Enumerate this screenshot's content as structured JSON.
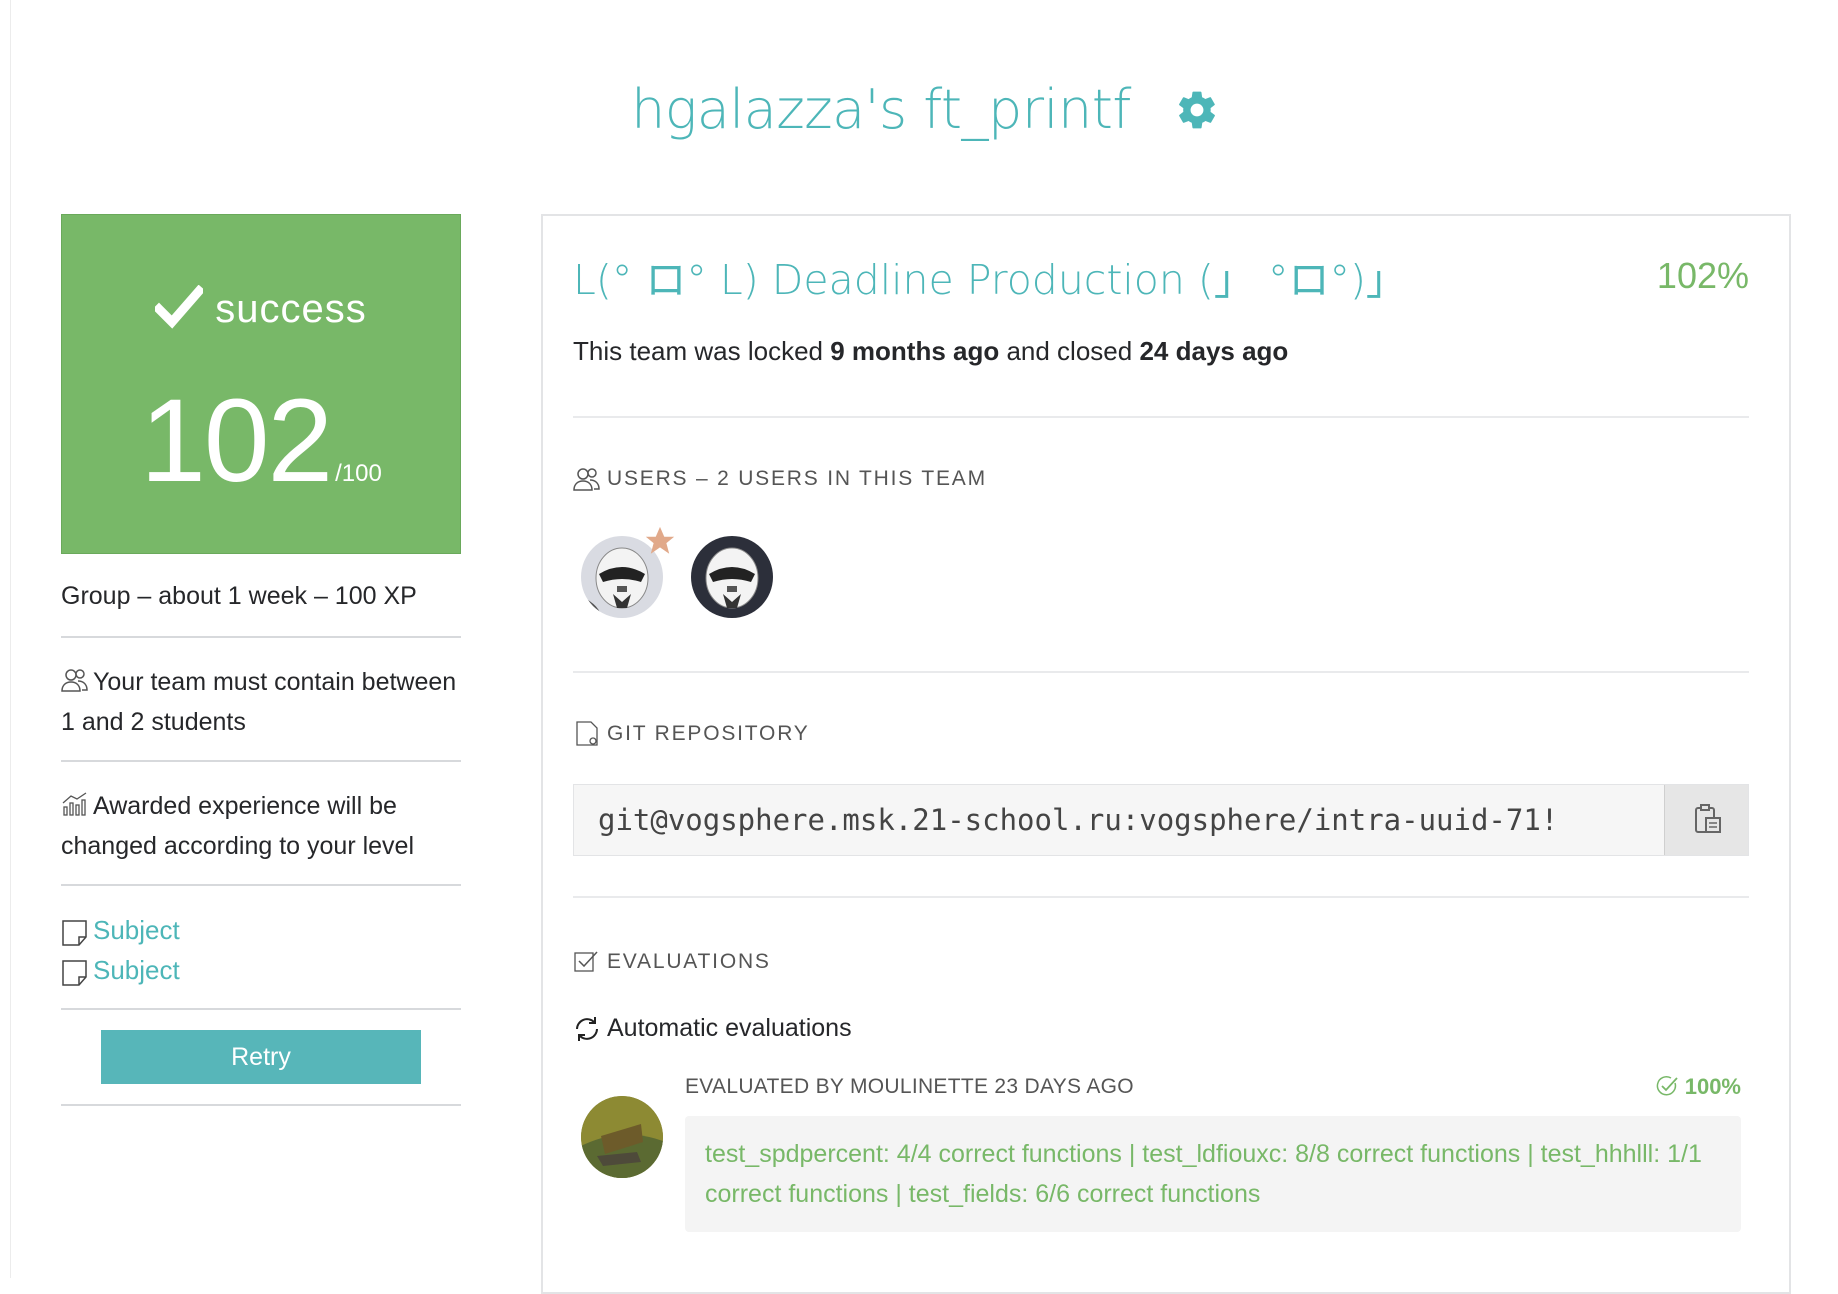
{
  "header": {
    "title": "hgalazza's ft_printf",
    "settings_icon": "gear-icon"
  },
  "status": {
    "label": "success",
    "score": "102",
    "max": "/100",
    "color": "#78b868"
  },
  "info": {
    "group_line": "Group – about 1 week – 100 XP",
    "team_size": "Your team must contain between 1 and 2 students",
    "experience": "Awarded experience will be changed according to your level",
    "subjects": [
      "Subject",
      "Subject"
    ],
    "retry_label": "Retry"
  },
  "team": {
    "name": "L(° ロ° L) Deadline Production (」 °ロ°)」",
    "percent": "102%",
    "lock_prefix": "This team was locked ",
    "lock_time": "9 months ago",
    "lock_mid": " and closed ",
    "close_time": "24 days ago"
  },
  "sections": {
    "users_title": "USERS – 2 USERS IN THIS TEAM",
    "git_title": "GIT REPOSITORY",
    "evaluations_title": "EVALUATIONS"
  },
  "repo": {
    "url": "git@vogsphere.msk.21-school.ru:vogsphere/intra-uuid-71!"
  },
  "evaluation": {
    "auto_label": "Automatic evaluations",
    "evaluated_by": "EVALUATED BY MOULINETTE 23 DAYS AGO",
    "score": "100%",
    "result_text": "test_spdpercent: 4/4 correct functions | test_ldfiouxc: 8/8 correct functions | test_hhhlll: 1/1 correct functions | test_fields: 6/6 correct functions"
  },
  "colors": {
    "accent": "#4db6b8",
    "success": "#78b868"
  }
}
